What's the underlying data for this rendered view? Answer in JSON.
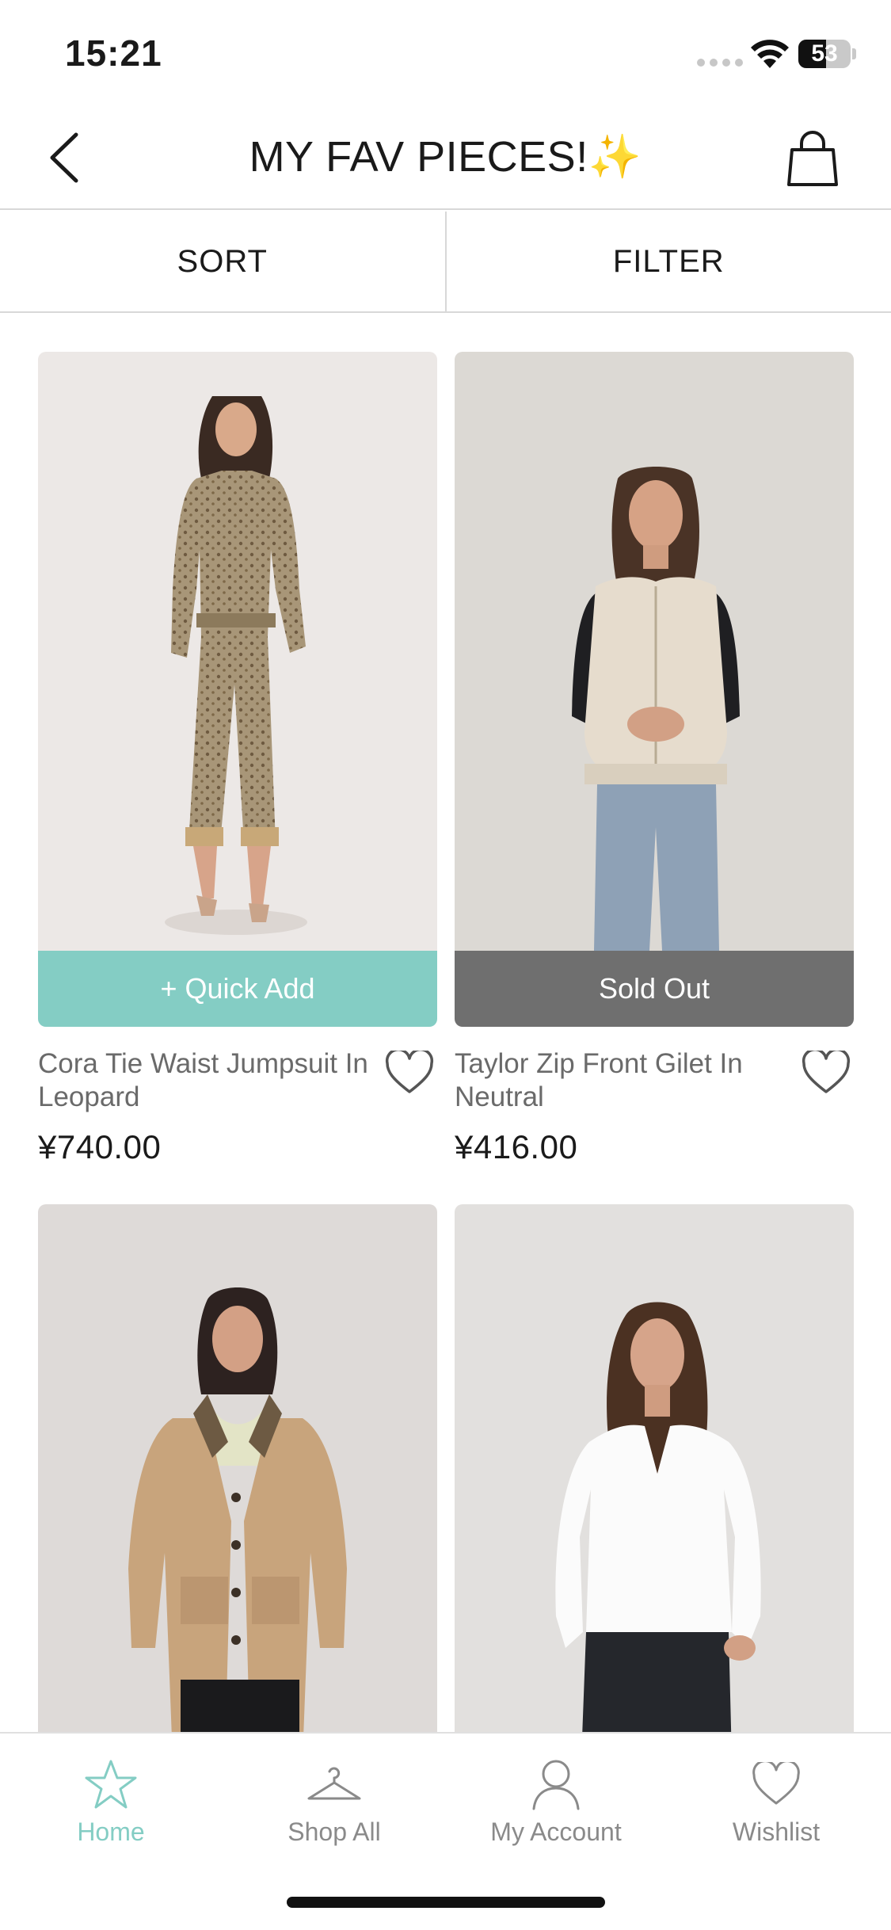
{
  "status_bar": {
    "time": "15:21",
    "battery_level": "53",
    "battery_fraction": 0.53
  },
  "header": {
    "title": "MY FAV PIECES!✨",
    "back_icon": "chevron-left-icon",
    "bag_icon": "shopping-bag-icon"
  },
  "toolbar": {
    "sort_label": "SORT",
    "filter_label": "FILTER"
  },
  "products": [
    {
      "name": "Cora Tie Waist Jumpsuit In Leopard",
      "price": "¥740.00",
      "action_label": "+ Quick Add",
      "action_state": "available",
      "action_color": "#84cdc4"
    },
    {
      "name": "Taylor Zip Front Gilet In Neutral",
      "price": "¥416.00",
      "action_label": "Sold Out",
      "action_state": "sold-out",
      "action_color": "#6f6f6f"
    },
    {
      "name": "",
      "price": ""
    },
    {
      "name": "",
      "price": ""
    }
  ],
  "tab_bar": {
    "items": [
      {
        "label": "Home",
        "icon": "star-icon",
        "active": true
      },
      {
        "label": "Shop All",
        "icon": "hanger-icon",
        "active": false
      },
      {
        "label": "My Account",
        "icon": "user-icon",
        "active": false
      },
      {
        "label": "Wishlist",
        "icon": "heart-icon",
        "active": false
      }
    ],
    "active_color": "#84cdc4",
    "inactive_color": "#8a8a8a"
  }
}
